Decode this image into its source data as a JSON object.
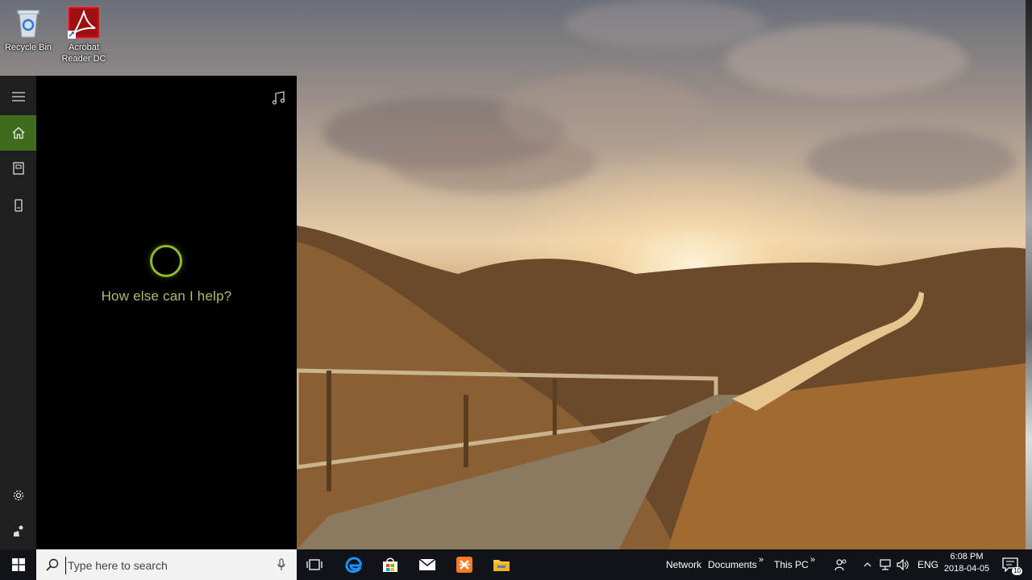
{
  "desktop": {
    "icons": [
      {
        "label": "Recycle Bin",
        "icon": "recycle-bin-icon"
      },
      {
        "label": "Acrobat Reader DC",
        "icon": "acrobat-reader-icon"
      }
    ]
  },
  "cortana": {
    "prompt": "How else can I help?",
    "rail": [
      "hamburger-menu-icon",
      "home-icon",
      "notebook-icon",
      "devices-icon",
      "settings-icon",
      "feedback-icon"
    ],
    "accent": "#3e6b1e",
    "ring_color": "#8fba2a"
  },
  "taskbar": {
    "search_placeholder": "Type here to search",
    "apps": [
      "task-view-icon",
      "edge-icon",
      "store-icon",
      "mail-icon",
      "xampp-icon",
      "file-explorer-icon"
    ],
    "toolbars": [
      {
        "label": "Network"
      },
      {
        "label": "Documents"
      },
      {
        "label": "This PC"
      }
    ],
    "language": "ENG",
    "time": "6:08 PM",
    "date": "2018-04-05",
    "notification_count": "10"
  }
}
